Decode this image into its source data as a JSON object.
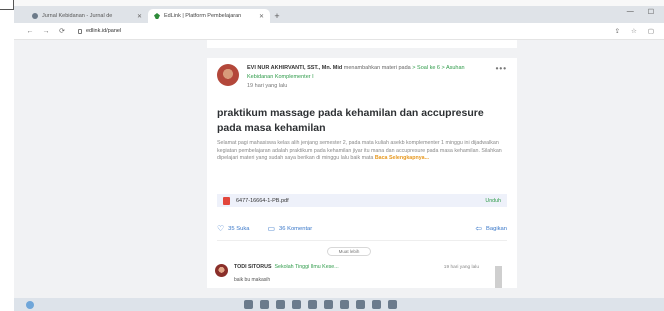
{
  "browser": {
    "tabs": [
      {
        "title": "Jurnal Kebidanan - Jurnal de",
        "icon": "globe-icon",
        "active": false
      },
      {
        "title": "EdLink | Platform Pembelajaran",
        "icon": "edlink-logo-icon",
        "active": true
      }
    ],
    "url": "edlink.id/panel"
  },
  "post": {
    "author": "EVI NUR AKHIRVANTI, SST., Mn. Mid",
    "action_text": "menambahkan materi pada",
    "breadcrumb_1": "Soal ke 6",
    "breadcrumb_sep": ">",
    "breadcrumb_2": "Asuhan Kebidanan Komplementer I",
    "time_ago": "19 hari yang lalu",
    "title": "praktikum massage pada kehamilan dan accupresure pada masa kehamilan",
    "body": "Selamat pagi mahasiswa kelas alih jenjang semester 2, pada mata kuliah asekb komplementer 1 minggu ini dijadwalkan kegiatan pembelajaran adalah praktikum pada kehamilan jiyar itu mana dan accupresure pada masa kehamilan. Silahkan dipelajari materi yang sudah saya berikan di minggu lalu baik mata",
    "read_more": "Baca Selengkapnya...",
    "attachment": {
      "name": "6477-16664-1-PB.pdf",
      "action": "Unduh"
    },
    "likes": "35 Suka",
    "comments": "36 Komentar",
    "share": "Bagikan",
    "more_comments": "Muat lebih"
  },
  "comment": {
    "author": "TODI SITORUS",
    "school": "Sekolah Tinggi Ilmu Kese...",
    "time": "19 hari yang lalu",
    "text": "baik bu makasih"
  }
}
